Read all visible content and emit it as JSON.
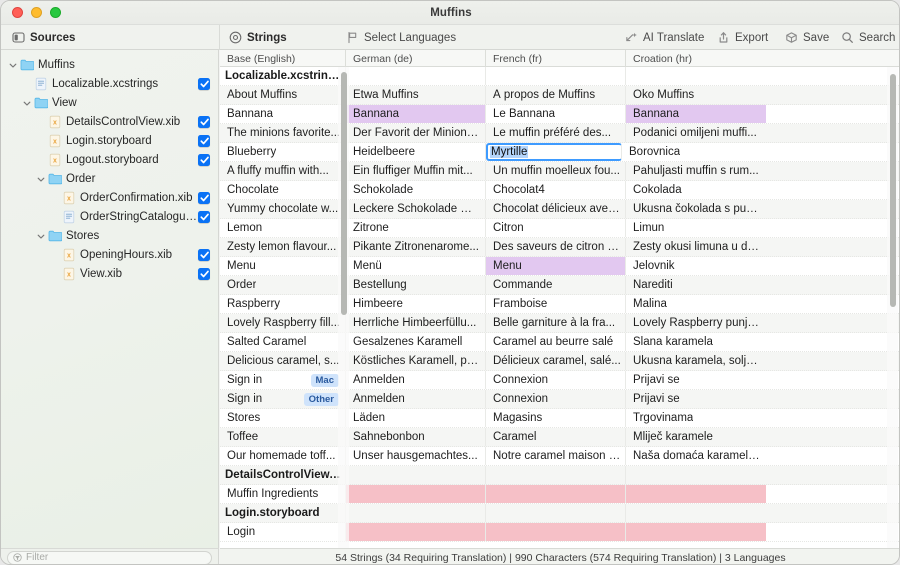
{
  "window": {
    "title": "Muffins"
  },
  "toolbar": {
    "sources_label": "Sources",
    "sources_icon": "sidebar-icon",
    "strings_label": "Strings",
    "strings_icon": "at-circle-icon",
    "select_languages_label": "Select Languages",
    "select_languages_icon": "flag-icon",
    "ai_translate_label": "AI Translate",
    "ai_translate_icon": "sparkle-arrow-icon",
    "export_label": "Export",
    "export_icon": "share-up-icon",
    "save_label": "Save",
    "save_icon": "box-icon",
    "search_label": "Search",
    "search_icon": "magnifier-icon"
  },
  "sidebar": {
    "tree": [
      {
        "label": "Muffins",
        "depth": 0,
        "icon": "folder-icon",
        "disclosure": "open",
        "checkbox": null
      },
      {
        "label": "Localizable.xcstrings",
        "depth": 1,
        "icon": "xcstrings-file-icon",
        "disclosure": null,
        "checkbox": true
      },
      {
        "label": "View",
        "depth": 1,
        "icon": "folder-icon",
        "disclosure": "open",
        "checkbox": null
      },
      {
        "label": "DetailsControlView.xib",
        "depth": 2,
        "icon": "xib-file-icon",
        "disclosure": null,
        "checkbox": true
      },
      {
        "label": "Login.storyboard",
        "depth": 2,
        "icon": "xib-file-icon",
        "disclosure": null,
        "checkbox": true
      },
      {
        "label": "Logout.storyboard",
        "depth": 2,
        "icon": "xib-file-icon",
        "disclosure": null,
        "checkbox": true
      },
      {
        "label": "Order",
        "depth": 2,
        "icon": "folder-icon",
        "disclosure": "open",
        "checkbox": null
      },
      {
        "label": "OrderConfirmation.xib",
        "depth": 3,
        "icon": "xib-file-icon",
        "disclosure": null,
        "checkbox": true
      },
      {
        "label": "OrderStringCatalogue....",
        "depth": 3,
        "icon": "xcstrings-file-icon",
        "disclosure": null,
        "checkbox": true
      },
      {
        "label": "Stores",
        "depth": 2,
        "icon": "folder-icon",
        "disclosure": "open",
        "checkbox": null
      },
      {
        "label": "OpeningHours.xib",
        "depth": 3,
        "icon": "xib-file-icon",
        "disclosure": null,
        "checkbox": true
      },
      {
        "label": "View.xib",
        "depth": 3,
        "icon": "xib-file-icon",
        "disclosure": null,
        "checkbox": true
      }
    ],
    "filter_placeholder": "Filter",
    "filter_value": "",
    "filter_icon": "filter-icon"
  },
  "table": {
    "columns": [
      {
        "label": "Base (English)"
      },
      {
        "label": "German (de)"
      },
      {
        "label": "French (fr)"
      },
      {
        "label": "Croation (hr)"
      }
    ],
    "rows": [
      {
        "type": "group",
        "cells": [
          "Localizable.xcstrings",
          "",
          "",
          ""
        ]
      },
      {
        "type": "entry",
        "cells": [
          "About Muffins",
          "Etwa Muffins",
          "À propos de Muffins",
          "Oko Muffins"
        ]
      },
      {
        "type": "entry",
        "cells": [
          "Bannana",
          "Bannana",
          "Le Bannana",
          "Bannana"
        ],
        "styles": [
          "",
          "purple",
          "",
          "purple"
        ]
      },
      {
        "type": "entry",
        "cells": [
          "The minions favorite...",
          "Der Favorit der Minions...",
          "Le muffin préféré des...",
          "Podanici omiljeni muffi..."
        ]
      },
      {
        "type": "entry",
        "cells": [
          "Blueberry",
          "Heidelbeere",
          "Myrtille",
          "Borovnica"
        ],
        "styles": [
          "",
          "",
          "editing",
          ""
        ]
      },
      {
        "type": "entry",
        "cells": [
          "A fluffy muffin with...",
          "Ein fluffiger Muffin mit...",
          "Un muffin moelleux fou...",
          "Pahuljasti muffin s rum..."
        ]
      },
      {
        "type": "entry",
        "cells": [
          "Chocolate",
          "Schokolade",
          "Chocolat4",
          "Čokolada"
        ]
      },
      {
        "type": "entry",
        "cells": [
          "Yummy chocolate w...",
          "Leckere Schokolade mi...",
          "Chocolat délicieux avec...",
          "Ukusna čokolada s pun..."
        ]
      },
      {
        "type": "entry",
        "cells": [
          "Lemon",
          "Zitrone",
          "Citron",
          "Limun"
        ]
      },
      {
        "type": "entry",
        "cells": [
          "Zesty lemon flavour...",
          "Pikante Zitronenarome...",
          "Des saveurs de citron p...",
          "Zesty okusi limuna u de..."
        ]
      },
      {
        "type": "entry",
        "cells": [
          "Menu",
          "Menü",
          "Menu",
          "Jelovnik"
        ],
        "styles": [
          "",
          "",
          "purple",
          ""
        ]
      },
      {
        "type": "entry",
        "cells": [
          "Order",
          "Bestellung",
          "Commande",
          "Narediti"
        ]
      },
      {
        "type": "entry",
        "cells": [
          "Raspberry",
          "Himbeere",
          "Framboise",
          "Malina"
        ]
      },
      {
        "type": "entry",
        "cells": [
          "Lovely Raspberry fill...",
          "Herrliche Himbeerfüllu...",
          "Belle garniture à la fra...",
          "Lovely Raspberry punje..."
        ]
      },
      {
        "type": "entry",
        "cells": [
          "Salted Caramel",
          "Gesalzenes Karamell",
          "Caramel au beurre salé",
          "Slana karamela"
        ]
      },
      {
        "type": "entry",
        "cells": [
          "Delicious caramel, s...",
          "Köstliches Karamell, pe...",
          "Délicieux caramel, salé...",
          "Ukusna karamela, solje..."
        ]
      },
      {
        "type": "entry",
        "cells": [
          "Sign in",
          "Anmelden",
          "Connexion",
          "Prijavi se"
        ],
        "badge": "Mac"
      },
      {
        "type": "entry",
        "cells": [
          "Sign in",
          "Anmelden",
          "Connexion",
          "Prijavi se"
        ],
        "badge": "Other"
      },
      {
        "type": "entry",
        "cells": [
          "Stores",
          "Läden",
          "Magasins",
          "Trgovinama"
        ]
      },
      {
        "type": "entry",
        "cells": [
          "Toffee",
          "Sahnebonbon",
          "Caramel",
          "Mliječ karamele"
        ]
      },
      {
        "type": "entry",
        "cells": [
          "Our homemade toff...",
          "Unser hausgemachtes...",
          "Notre caramel maison f...",
          "Naša domaća karamela..."
        ]
      },
      {
        "type": "group",
        "cells": [
          "DetailsControlView....",
          "",
          "",
          ""
        ]
      },
      {
        "type": "entry",
        "cells": [
          "Muffin Ingredients",
          "",
          "",
          ""
        ],
        "styles": [
          "",
          "pink",
          "pink",
          "pink"
        ]
      },
      {
        "type": "group",
        "cells": [
          "Login.storyboard",
          "",
          "",
          ""
        ]
      },
      {
        "type": "entry",
        "cells": [
          "Login",
          "",
          "",
          ""
        ],
        "styles": [
          "",
          "pink",
          "pink",
          "pink"
        ]
      }
    ]
  },
  "status": {
    "text": "54 Strings (34 Requiring Translation) | 990 Characters (574 Requiring Translation) | 3 Languages"
  },
  "colors": {
    "accent_blue": "#0a72f5",
    "highlight_purple": "#e2c8f0",
    "missing_pink": "#f6c0c7",
    "selection_blue": "#b4d5fb",
    "badge_blue": "#cfe3fb"
  }
}
